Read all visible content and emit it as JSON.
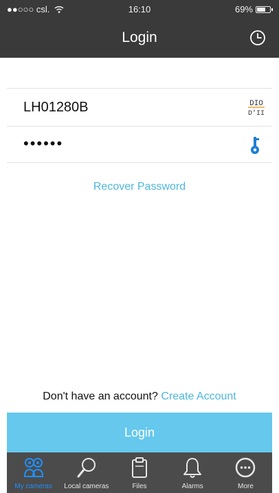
{
  "status_bar": {
    "carrier": "●●○○○ csl.",
    "wifi_icon": "wifi-icon",
    "time": "16:10",
    "battery_percent": "69%",
    "battery_level": 0.69
  },
  "nav_bar": {
    "title": "Login",
    "history_icon": "clock-icon"
  },
  "form": {
    "username_value": "LH01280B",
    "password_value": "••••••",
    "qr_icon": "qr-scan-icon",
    "key_icon": "key-icon",
    "recover_password": "Recover Password"
  },
  "signup": {
    "prompt": "Don't have an account?",
    "link": "Create Account"
  },
  "login_button": "Login",
  "tabs": [
    {
      "label": "My cameras",
      "icon": "cameras-icon",
      "active": true
    },
    {
      "label": "Local cameras",
      "icon": "search-icon",
      "active": false
    },
    {
      "label": "Files",
      "icon": "clipboard-icon",
      "active": false
    },
    {
      "label": "Alarms",
      "icon": "bell-icon",
      "active": false
    },
    {
      "label": "More",
      "icon": "more-icon",
      "active": false
    }
  ],
  "colors": {
    "header_bg": "#3a3a3a",
    "accent": "#4db7de",
    "login_button_bg": "#66c8ec",
    "tab_bar_bg": "#4b4b4b",
    "active_tab": "#1e90ff"
  }
}
